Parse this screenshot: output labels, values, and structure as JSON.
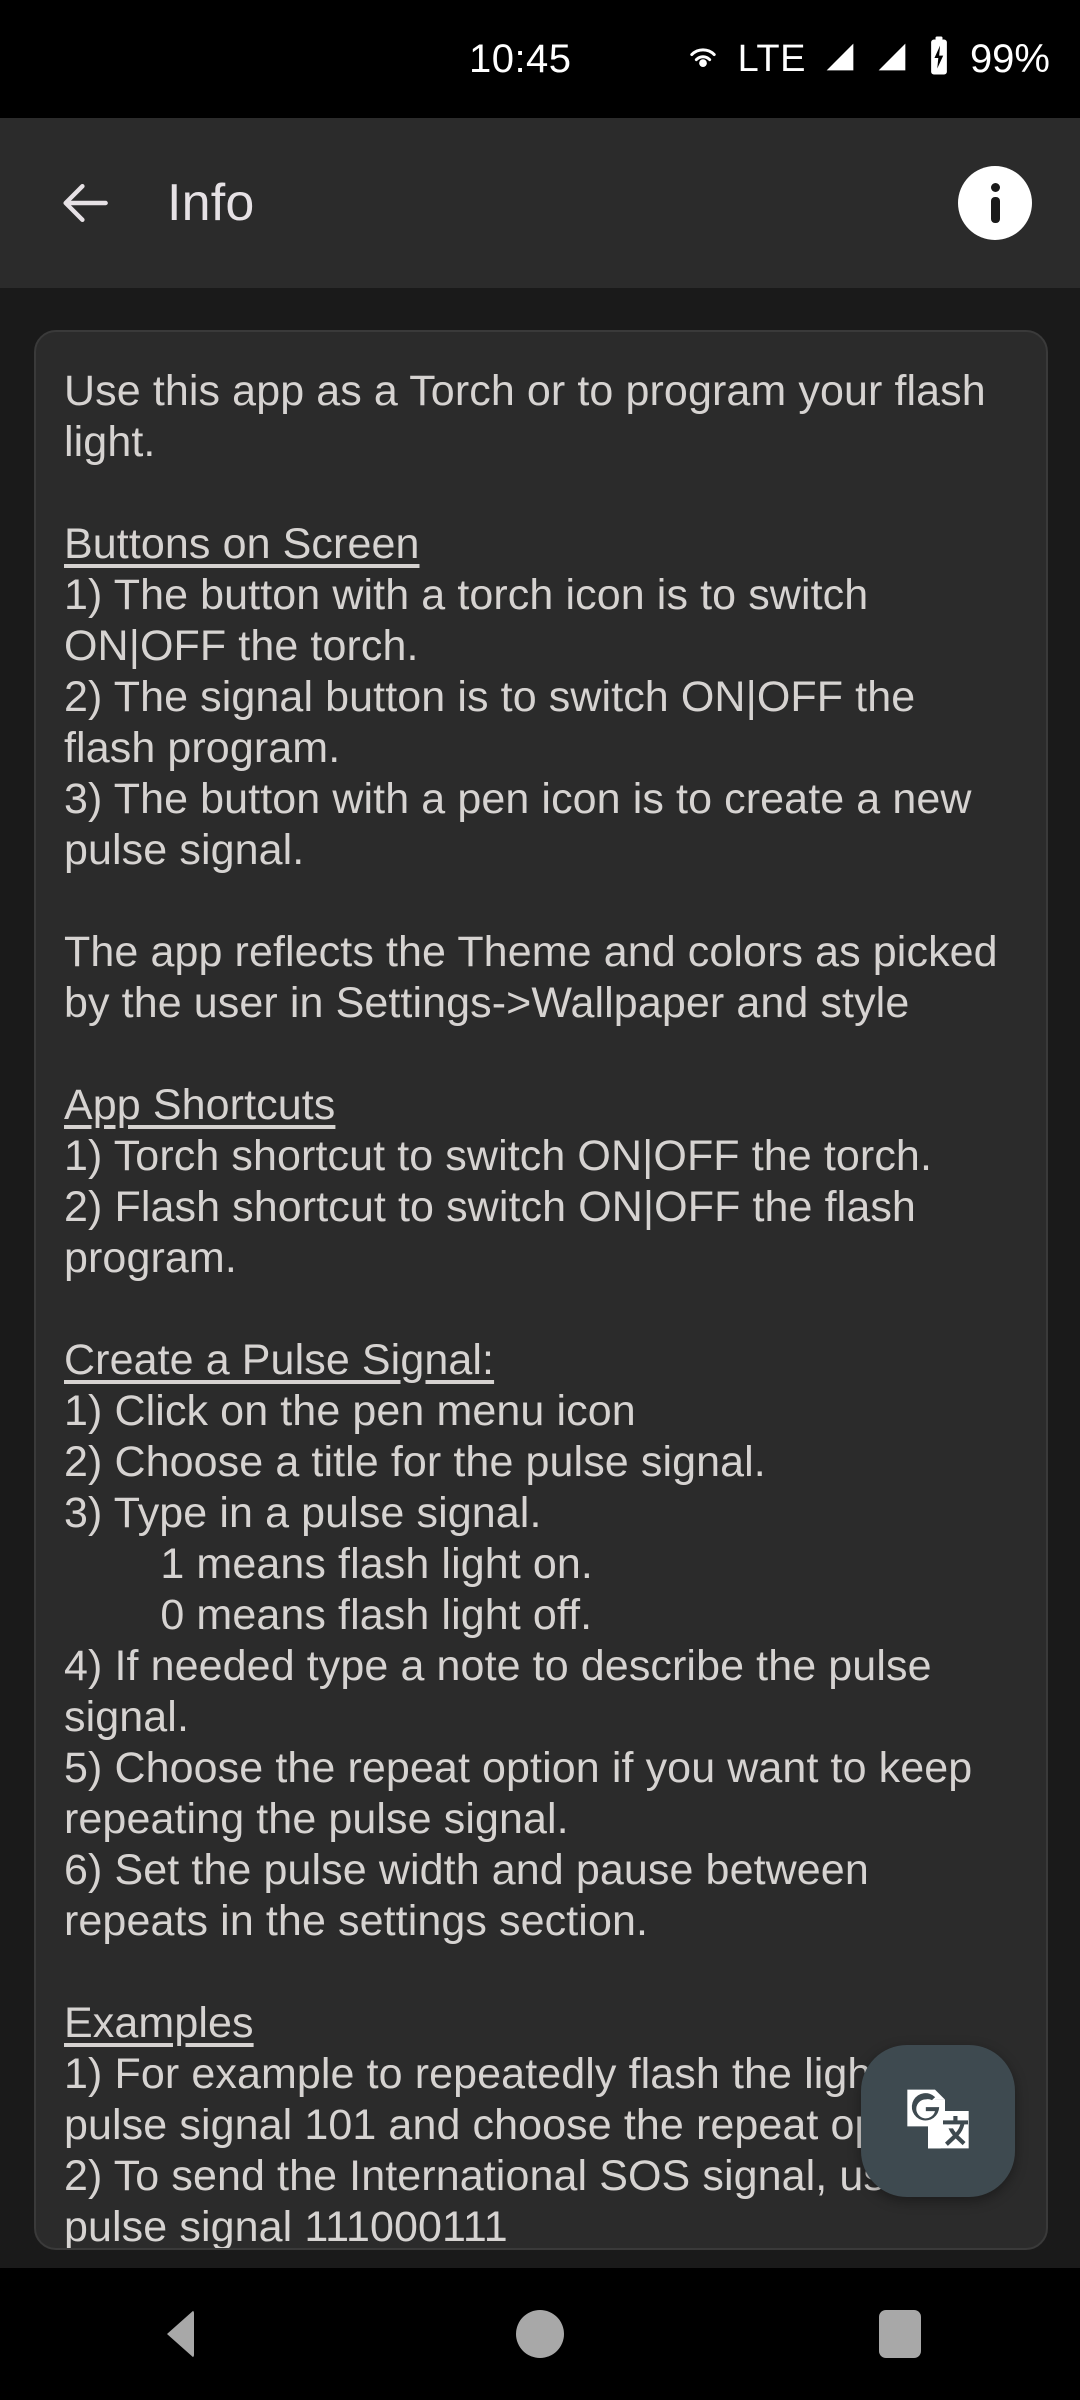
{
  "status_bar": {
    "time": "10:45",
    "network_label": "LTE",
    "battery_percent": "99%",
    "icons": [
      "hotspot-icon",
      "signal-bars-1-icon",
      "signal-bars-2-icon",
      "battery-charging-icon"
    ]
  },
  "app_bar": {
    "back_label": "back-arrow",
    "title": "Info",
    "action_icon": "info-icon"
  },
  "content": {
    "body": "Use this app as a Torch or to program your flash light.\n\nButtons on Screen\n1) The button with a torch icon is to switch ON|OFF the torch.\n2) The signal button is to switch ON|OFF the flash program.\n3) The button with a pen icon is to create a new pulse signal.\n\nThe app reflects the Theme and colors as picked by the user in Settings->Wallpaper and style\n\nApp Shortcuts\n1) Torch shortcut to switch ON|OFF the torch.\n2) Flash shortcut to switch ON|OFF the flash program.\n\nCreate a Pulse Signal:\n1) Click on the pen menu icon\n2) Choose a title for the pulse signal.\n3) Type in a pulse signal.\n        1 means flash light on.\n        0 means flash light off.\n4) If needed type a note to describe the pulse signal.\n5) Choose the repeat option if you want to keep repeating the pulse signal.\n6) Set the pulse width and pause between repeats in the settings section.\n\nExamples\n1) For example to repeatedly flash the light use pulse signal 101 and choose the repeat option.\n2) To send the International SOS signal, use the pulse signal 111000111",
    "headings": [
      "Buttons on Screen",
      "App Shortcuts",
      "Create a Pulse Signal:",
      "Examples"
    ]
  },
  "fab": {
    "name": "google-translate-button",
    "icon": "translate-icon"
  },
  "nav_bar": {
    "buttons": [
      "back-button",
      "home-button",
      "recents-button"
    ]
  },
  "colors": {
    "page_background": "#1a1a1a",
    "status_bar_background": "#000000",
    "app_bar_background": "#2b2b2b",
    "card_background": "#2b2b2b",
    "card_border": "#3a3a3a",
    "text": "#d6d3d1",
    "title_text": "#e6e1e5",
    "fab_background": "#3e4a50",
    "nav_icon": "#a8a8a8"
  }
}
